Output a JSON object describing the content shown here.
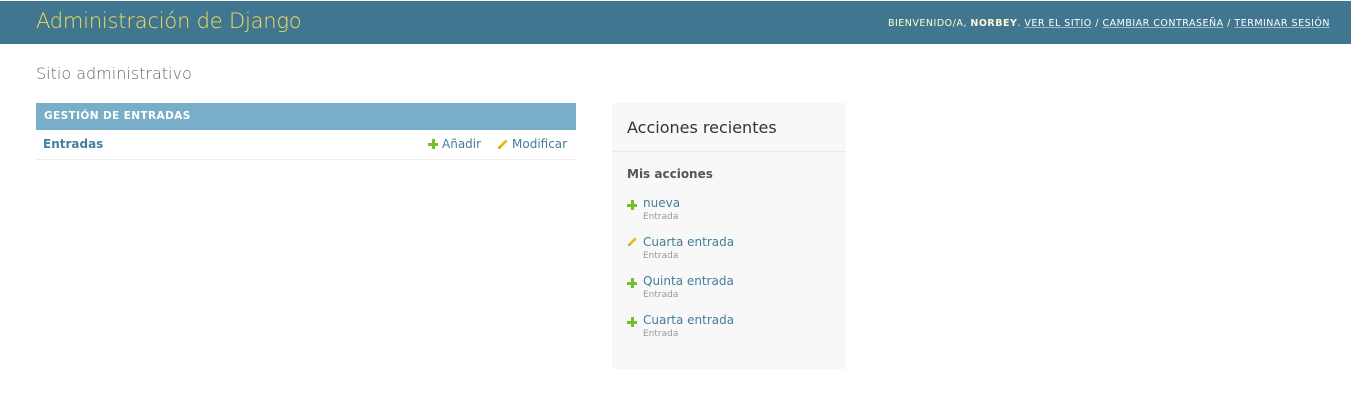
{
  "header": {
    "site_title": "Administración de Django",
    "welcome": "BIENVENIDO/A,",
    "username": "NORBEY",
    "view_site": "VER EL SITIO",
    "change_password": "CAMBIAR CONTRASEÑA",
    "logout": "TERMINAR SESIÓN",
    "separator": "/"
  },
  "page": {
    "title": "Sitio administrativo"
  },
  "module": {
    "caption": "GESTIÓN DE ENTRADAS",
    "model_name": "Entradas",
    "add_label": "Añadir",
    "change_label": "Modificar"
  },
  "recent_actions": {
    "title": "Acciones recientes",
    "subtitle": "Mis acciones",
    "items": [
      {
        "icon": "add-icon",
        "name": "nueva",
        "type": "Entrada"
      },
      {
        "icon": "edit-icon",
        "name": "Cuarta entrada",
        "type": "Entrada"
      },
      {
        "icon": "add-icon",
        "name": "Quinta entrada",
        "type": "Entrada"
      },
      {
        "icon": "add-icon",
        "name": "Cuarta entrada",
        "type": "Entrada"
      }
    ]
  },
  "colors": {
    "header_bg": "#417690",
    "branding": "#f5dd5d",
    "module_caption_bg": "#79aec8",
    "link": "#447e9b",
    "add_green": "#70bf2b",
    "edit_yellow": "#efb80b",
    "sidebar_bg": "#f8f8f8"
  }
}
